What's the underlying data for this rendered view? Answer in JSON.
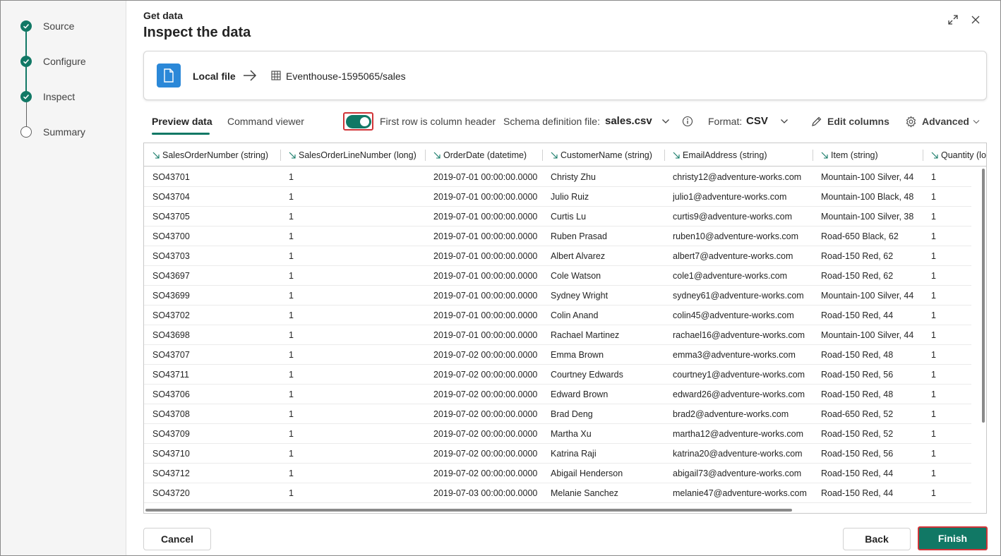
{
  "stepper": [
    {
      "label": "Source",
      "state": "done"
    },
    {
      "label": "Configure",
      "state": "done"
    },
    {
      "label": "Inspect",
      "state": "current"
    },
    {
      "label": "Summary",
      "state": "pending"
    }
  ],
  "header": {
    "kicker": "Get data",
    "title": "Inspect the data"
  },
  "source": {
    "name": "Local file",
    "destination": "Eventhouse-1595065/sales"
  },
  "tabs": [
    {
      "label": "Preview data",
      "active": true
    },
    {
      "label": "Command viewer",
      "active": false
    }
  ],
  "toolbar": {
    "first_row_header_label": "First row is column header",
    "first_row_header_on": true,
    "schema_label": "Schema definition file:",
    "schema_value": "sales.csv",
    "format_label": "Format:",
    "format_value": "CSV",
    "edit_columns": "Edit columns",
    "advanced": "Advanced"
  },
  "table": {
    "columns": [
      "SalesOrderNumber (string)",
      "SalesOrderLineNumber (long)",
      "OrderDate (datetime)",
      "CustomerName (string)",
      "EmailAddress (string)",
      "Item (string)",
      "Quantity (lo"
    ],
    "rows": [
      [
        "SO43701",
        "1",
        "2019-07-01 00:00:00.0000",
        "Christy Zhu",
        "christy12@adventure-works.com",
        "Mountain-100 Silver, 44",
        "1"
      ],
      [
        "SO43704",
        "1",
        "2019-07-01 00:00:00.0000",
        "Julio Ruiz",
        "julio1@adventure-works.com",
        "Mountain-100 Black, 48",
        "1"
      ],
      [
        "SO43705",
        "1",
        "2019-07-01 00:00:00.0000",
        "Curtis Lu",
        "curtis9@adventure-works.com",
        "Mountain-100 Silver, 38",
        "1"
      ],
      [
        "SO43700",
        "1",
        "2019-07-01 00:00:00.0000",
        "Ruben Prasad",
        "ruben10@adventure-works.com",
        "Road-650 Black, 62",
        "1"
      ],
      [
        "SO43703",
        "1",
        "2019-07-01 00:00:00.0000",
        "Albert Alvarez",
        "albert7@adventure-works.com",
        "Road-150 Red, 62",
        "1"
      ],
      [
        "SO43697",
        "1",
        "2019-07-01 00:00:00.0000",
        "Cole Watson",
        "cole1@adventure-works.com",
        "Road-150 Red, 62",
        "1"
      ],
      [
        "SO43699",
        "1",
        "2019-07-01 00:00:00.0000",
        "Sydney Wright",
        "sydney61@adventure-works.com",
        "Mountain-100 Silver, 44",
        "1"
      ],
      [
        "SO43702",
        "1",
        "2019-07-01 00:00:00.0000",
        "Colin Anand",
        "colin45@adventure-works.com",
        "Road-150 Red, 44",
        "1"
      ],
      [
        "SO43698",
        "1",
        "2019-07-01 00:00:00.0000",
        "Rachael Martinez",
        "rachael16@adventure-works.com",
        "Mountain-100 Silver, 44",
        "1"
      ],
      [
        "SO43707",
        "1",
        "2019-07-02 00:00:00.0000",
        "Emma Brown",
        "emma3@adventure-works.com",
        "Road-150 Red, 48",
        "1"
      ],
      [
        "SO43711",
        "1",
        "2019-07-02 00:00:00.0000",
        "Courtney Edwards",
        "courtney1@adventure-works.com",
        "Road-150 Red, 56",
        "1"
      ],
      [
        "SO43706",
        "1",
        "2019-07-02 00:00:00.0000",
        "Edward Brown",
        "edward26@adventure-works.com",
        "Road-150 Red, 48",
        "1"
      ],
      [
        "SO43708",
        "1",
        "2019-07-02 00:00:00.0000",
        "Brad Deng",
        "brad2@adventure-works.com",
        "Road-650 Red, 52",
        "1"
      ],
      [
        "SO43709",
        "1",
        "2019-07-02 00:00:00.0000",
        "Martha Xu",
        "martha12@adventure-works.com",
        "Road-150 Red, 52",
        "1"
      ],
      [
        "SO43710",
        "1",
        "2019-07-02 00:00:00.0000",
        "Katrina Raji",
        "katrina20@adventure-works.com",
        "Road-150 Red, 56",
        "1"
      ],
      [
        "SO43712",
        "1",
        "2019-07-02 00:00:00.0000",
        "Abigail Henderson",
        "abigail73@adventure-works.com",
        "Road-150 Red, 44",
        "1"
      ],
      [
        "SO43720",
        "1",
        "2019-07-03 00:00:00.0000",
        "Melanie Sanchez",
        "melanie47@adventure-works.com",
        "Road-150 Red, 44",
        "1"
      ]
    ]
  },
  "buttons": {
    "cancel": "Cancel",
    "back": "Back",
    "finish": "Finish"
  },
  "colors": {
    "accent": "#117865",
    "highlight": "#d13438",
    "file_icon": "#2b88d8"
  }
}
